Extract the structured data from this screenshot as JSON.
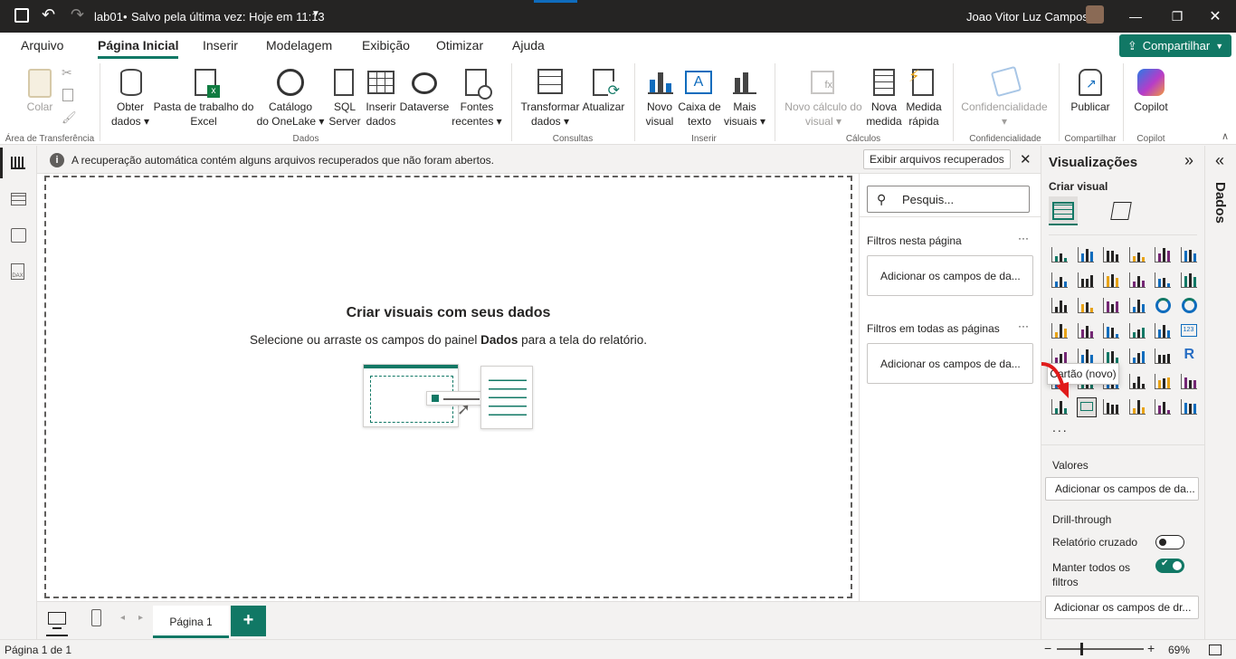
{
  "titlebar": {
    "file_name": "lab01",
    "save_status": "Salvo pela última vez: Hoje em 11:13",
    "user_name": "Joao Vitor Luz Campos"
  },
  "menu": {
    "tabs": [
      "Arquivo",
      "Página Inicial",
      "Inserir",
      "Modelagem",
      "Exibição",
      "Otimizar",
      "Ajuda"
    ],
    "active_tab": "Página Inicial",
    "share_label": "Compartilhar"
  },
  "ribbon": {
    "colar": "Colar",
    "grp_transfer": "Área de Transferência",
    "obter_1": "Obter",
    "obter_2": "dados",
    "pasta_1": "Pasta de trabalho do",
    "pasta_2": "Excel",
    "catalogo_1": "Catálogo",
    "catalogo_2": "do OneLake",
    "sql_1": "SQL",
    "sql_2": "Server",
    "inserir_1": "Inserir",
    "inserir_2": "dados",
    "dataverse": "Dataverse",
    "fontes_1": "Fontes",
    "fontes_2": "recentes",
    "grp_dados": "Dados",
    "transformar_1": "Transformar",
    "transformar_2": "dados",
    "atualizar": "Atualizar",
    "grp_consultas": "Consultas",
    "novo_visual_1": "Novo",
    "novo_visual_2": "visual",
    "caixa_1": "Caixa de",
    "caixa_2": "texto",
    "mais_1": "Mais",
    "mais_2": "visuais",
    "grp_inserir": "Inserir",
    "novo_calc_1": "Novo cálculo do",
    "novo_calc_2": "visual",
    "nova_medida_1": "Nova",
    "nova_medida_2": "medida",
    "medida_rapida_1": "Medida",
    "medida_rapida_2": "rápida",
    "grp_calculos": "Cálculos",
    "confid": "Confidencialidade",
    "grp_confid": "Confidencialidade",
    "publicar": "Publicar",
    "grp_compartilhar": "Compartilhar",
    "copilot": "Copilot",
    "grp_copilot": "Copilot"
  },
  "infobar": {
    "message": "A recuperação automática contém alguns arquivos recuperados que não foram abertos.",
    "action": "Exibir arquivos recuperados"
  },
  "canvas": {
    "title": "Criar visuais com seus dados",
    "subtitle_pre": "Selecione ou arraste os campos do painel ",
    "subtitle_bold": "Dados",
    "subtitle_post": " para a tela do relatório."
  },
  "filters": {
    "search_placeholder": "Pesquis...",
    "page_filters": "Filtros nesta página",
    "all_pages_filters": "Filtros em todas as páginas",
    "add_fields": "Adicionar os campos de da..."
  },
  "viz": {
    "title": "Visualizações",
    "build_visual": "Criar visual",
    "tooltip": "Cartão (novo)",
    "values": "Valores",
    "add_fields": "Adicionar os campos de da...",
    "drillthrough": "Drill-through",
    "cross_report": "Relatório cruzado",
    "keep_filters_1": "Manter todos os",
    "keep_filters_2": "filtros",
    "add_drill": "Adicionar os campos de dr...",
    "more": "...",
    "accent": "#117865"
  },
  "data_pane": {
    "label": "Dados"
  },
  "pages": {
    "tab": "Página 1"
  },
  "status": {
    "page_info": "Página 1 de 1",
    "zoom": "69%"
  }
}
